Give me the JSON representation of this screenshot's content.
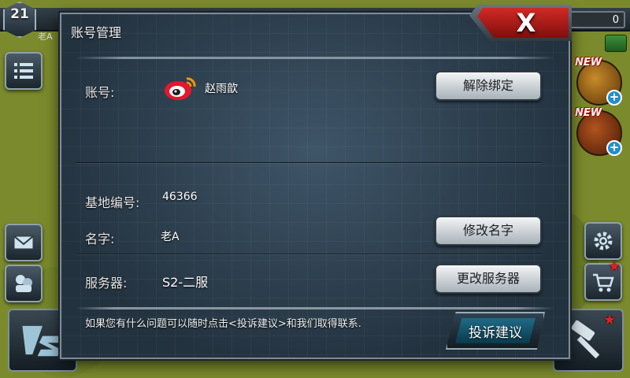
{
  "hud": {
    "level": "21",
    "player_name": "老A",
    "resource_value": "0"
  },
  "dialog": {
    "title": "账号管理",
    "close_label": "X",
    "account": {
      "label": "账号:",
      "provider_icon": "weibo-icon",
      "value": "赵雨歆",
      "unbind_button": "解除绑定"
    },
    "base_id": {
      "label": "基地编号:",
      "value": "46366"
    },
    "name": {
      "label": "名字:",
      "value": "老A",
      "change_button": "修改名字"
    },
    "server": {
      "label": "服务器:",
      "value": "S2-二服",
      "change_button": "更改服务器"
    },
    "footer_text": "如果您有什么问题可以随时点击<投诉建议>和我们取得联系.",
    "feedback_button": "投诉建议"
  },
  "side_menu": {
    "new_badge": "NEW",
    "plus": "+",
    "star": "★"
  },
  "colors": {
    "dialog_bg": "#2f4252",
    "close_red": "#c5221d",
    "button_light": "#e3e8eb",
    "feedback_teal": "#1b5f79"
  }
}
